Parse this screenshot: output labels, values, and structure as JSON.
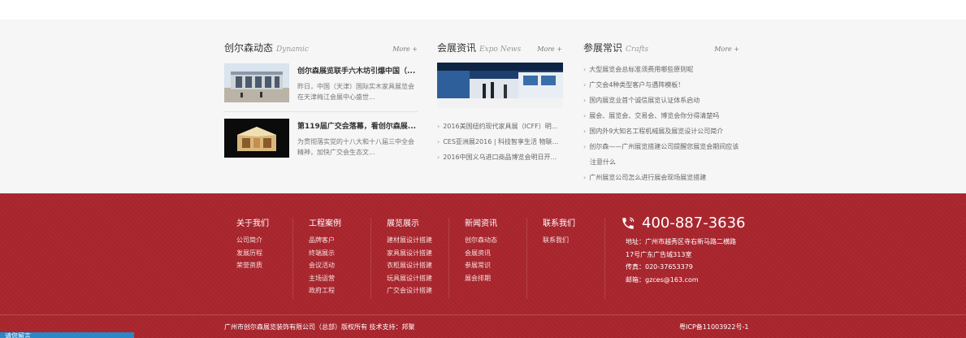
{
  "dynamic": {
    "title": "创尔森动态",
    "title_en": "Dynamic",
    "more": "More +",
    "items": [
      {
        "title": "创尔森展览联手六木坊引爆中国（...",
        "desc": "昨日，中国（天津）国际实木家具展览会在天津梅江会展中心盛世..."
      },
      {
        "title": "第119届广交会落幕，看创尔森展...",
        "desc": "为贯彻落实党的十八大和十八届三中全会精神，加快广交会生态文..."
      }
    ]
  },
  "expo": {
    "title": "会展资讯",
    "title_en": "Expo News",
    "more": "More +",
    "items": [
      "2016美国纽约现代家具展（ICFF）明...",
      "CES亚洲展2016 | 科技智享生活 物联...",
      "2016中国义乌进口商品博览会明日开..."
    ]
  },
  "crafts": {
    "title": "参展常识",
    "title_en": "Crafts",
    "more": "More +",
    "items": [
      "大型展览会总标准须费用哪些原则呢",
      "广交会4种类型客户与遇阵模板！",
      "国内展览业首个诚信展览认证体系启动",
      "展会、展览会、交易会、博览会你分得清楚吗",
      "国内外9大知名工程机械展及展览设计公司简介",
      "创尔森——广州展览搭建公司提醒您展览会期间应该注意什么",
      "广州展览公司怎么进行展会现场展览搭建"
    ]
  },
  "footer": {
    "columns": [
      {
        "head": "关于我们",
        "links": [
          "公司简介",
          "发展历程",
          "荣誉资质"
        ]
      },
      {
        "head": "工程案例",
        "links": [
          "品牌客户",
          "终端展示",
          "会议活动",
          "主场运营",
          "政府工程"
        ]
      },
      {
        "head": "展览展示",
        "links": [
          "建材展设计搭建",
          "家具展设计搭建",
          "衣柜展设计搭建",
          "玩具展设计搭建",
          "广交会设计搭建"
        ]
      },
      {
        "head": "新闻资讯",
        "links": [
          "创尔森动态",
          "会展资讯",
          "参展常识",
          "展会排期"
        ]
      },
      {
        "head": "联系我们",
        "links": [
          "联系我们"
        ]
      }
    ],
    "phone": "400-887-3636",
    "address": "地址：广州市越秀区寺右新马路二横路17号广东广告城313室",
    "fax": "传真：020-37653379",
    "email": "邮箱：gzces@163.com",
    "copyright": "广州市创尔森展览装饰有限公司（总部）版权所有   技术支持：邦聚",
    "icp": "粤ICP备11003922号-1"
  },
  "chat": {
    "label": "请您留言"
  },
  "colors": {
    "footer_bg": "#a9252d",
    "band_bg": "#f6f6f6",
    "accent_blue": "#2b87c8"
  }
}
